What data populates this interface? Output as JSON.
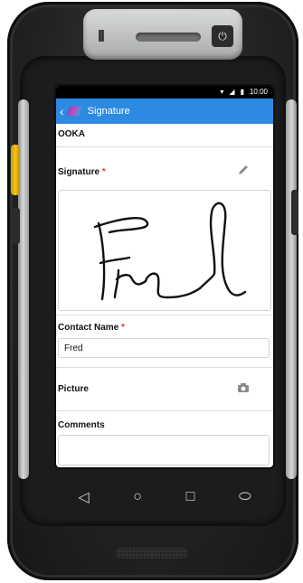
{
  "status_bar": {
    "time": "10:00",
    "icons": [
      "wifi-icon",
      "signal-icon",
      "battery-icon"
    ]
  },
  "app_bar": {
    "back": "‹",
    "title": "Signature"
  },
  "form": {
    "record": "OOKA",
    "signature_label": "Signature",
    "required_mark": "*",
    "signature_text": "Fred",
    "contact_label": "Contact Name",
    "contact_value": "Fred",
    "picture_label": "Picture",
    "comments_label": "Comments"
  },
  "nav": {
    "back": "◁",
    "home": "○",
    "recents": "□",
    "extra": "⬭"
  },
  "device": {
    "cap_bars": "II",
    "power": "⏻"
  },
  "colors": {
    "accent": "#2c8ae2",
    "required": "#e23b3b"
  }
}
